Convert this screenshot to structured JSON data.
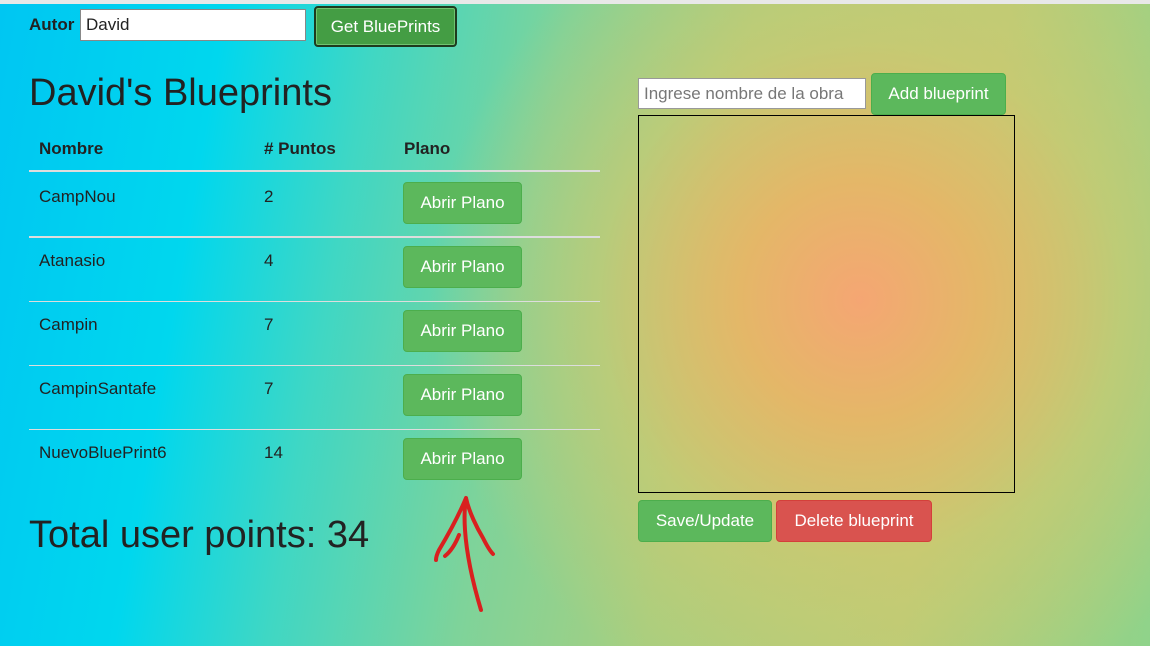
{
  "header": {
    "author_label": "Autor",
    "author_value": "David",
    "get_button": "Get BluePrints"
  },
  "main": {
    "title": "David's Blueprints",
    "columns": [
      "Nombre",
      "# Puntos",
      "Plano"
    ],
    "rows": [
      {
        "name": "CampNou",
        "points": "2",
        "action": "Abrir Plano"
      },
      {
        "name": "Atanasio",
        "points": "4",
        "action": "Abrir Plano"
      },
      {
        "name": "Campin",
        "points": "7",
        "action": "Abrir Plano"
      },
      {
        "name": "CampinSantafe",
        "points": "7",
        "action": "Abrir Plano"
      },
      {
        "name": "NuevoBluePrint6",
        "points": "14",
        "action": "Abrir Plano"
      }
    ],
    "total": "Total user points: 34"
  },
  "editor": {
    "name_placeholder": "Ingrese nombre de la obra",
    "add_button": "Add blueprint",
    "save_button": "Save/Update",
    "delete_button": "Delete blueprint"
  },
  "colors": {
    "success": "#5cb85c",
    "danger": "#d9534f",
    "annotation": "#d9201f"
  }
}
